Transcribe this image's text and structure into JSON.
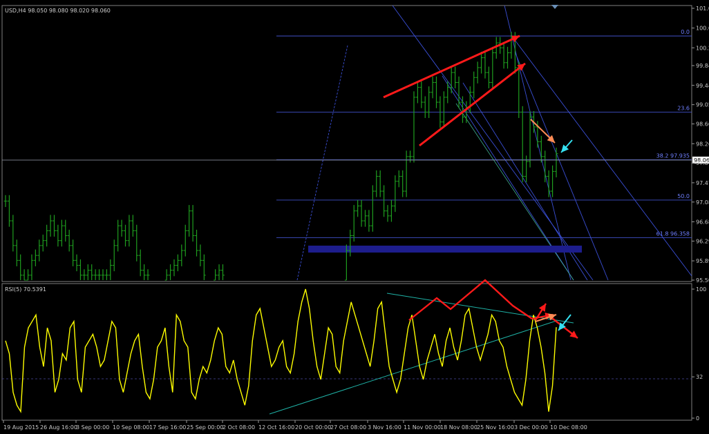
{
  "header": {
    "price_title": "USD,H4  98.050 98.080 98.020 98.060",
    "rsi_title": "RSI(5) 70.5391"
  },
  "current_price": "98.06",
  "colors": {
    "background": "#000000",
    "grid_frame": "#7f7f7f",
    "price": "#1f9f1f",
    "rsi": "#ffff00",
    "fib": "#4050c8",
    "trend": "#3a4fd6",
    "arrow_red": "#ff1a1a",
    "arrow_orange": "#ff8c55",
    "arrow_cyan": "#35e0f0",
    "rsi_trend": "#1fb3a7",
    "zone": "#1d1d8c"
  },
  "chart_data": [
    {
      "type": "line",
      "title": "USD,H4",
      "ylim": [
        95.5,
        101.0
      ],
      "y_ticks": [
        "101.0",
        "100.6",
        "100.2",
        "99.84",
        "99.44",
        "99.05",
        "98.66",
        "98.26",
        "97.87",
        "97.47",
        "97.08",
        "96.68",
        "96.29",
        "95.89",
        "95.50"
      ],
      "x_ticks": [
        "19 Aug 2015",
        "26 Aug 16:00",
        "3 Sep 00:00",
        "10 Sep 08:00",
        "17 Sep 16:00",
        "25 Sep 00:00",
        "2 Oct 08:00",
        "12 Oct 16:00",
        "20 Oct 00:00",
        "27 Oct 08:00",
        "3 Nov 16:00",
        "11 Nov 00:00",
        "18 Nov 08:00",
        "25 Nov 16:00",
        "3 Dec 00:00",
        "10 Dec 08:00"
      ],
      "fib_levels": [
        {
          "label": "0.0",
          "value": 100.44
        },
        {
          "label": "23.6",
          "value": 98.9
        },
        {
          "label": "38.2  97.935",
          "value": 97.935
        },
        {
          "label": "50.0",
          "value": 97.12
        },
        {
          "label": "61.8  96.358",
          "value": 96.358
        }
      ],
      "series": [
        {
          "values": [
            97.1,
            96.7,
            96.2,
            95.9,
            95.6,
            95.5,
            95.6,
            95.9,
            96.0,
            96.2,
            96.3,
            96.5,
            96.7,
            96.5,
            96.3,
            96.6,
            96.4,
            96.2,
            95.9,
            95.8,
            95.6,
            95.6,
            95.7,
            95.6,
            95.6,
            95.6,
            95.6,
            95.6,
            95.8,
            96.2,
            96.6,
            96.5,
            96.3,
            96.7,
            96.5,
            96.0,
            95.7,
            95.6,
            95.6,
            95.5,
            95.5,
            95.5,
            95.5,
            95.6,
            95.7,
            95.8,
            95.9,
            96.1,
            96.5,
            96.9,
            96.4,
            96.1,
            95.9,
            95.6,
            95.5,
            95.5,
            95.6,
            95.7,
            95.6,
            95.5,
            95.5,
            95.5,
            95.5,
            95.5,
            95.5,
            95.5,
            95.5,
            95.5,
            95.5,
            95.5,
            95.5,
            95.5,
            95.5,
            95.5,
            95.5,
            95.5,
            95.5,
            95.5,
            95.5,
            95.5,
            95.5,
            95.5,
            95.5,
            95.5,
            95.5,
            95.5,
            95.5,
            95.5,
            95.5,
            95.5,
            95.5,
            96.1,
            96.4,
            96.9,
            97.0,
            96.7,
            96.8,
            96.6,
            97.3,
            97.6,
            97.3,
            96.9,
            96.8,
            97.0,
            97.5,
            97.6,
            97.3,
            98.0,
            98.0,
            99.2,
            99.4,
            99.1,
            98.9,
            99.3,
            99.5,
            99.1,
            98.7,
            99.2,
            99.4,
            99.7,
            99.5,
            99.1,
            98.8,
            99.0,
            99.3,
            99.6,
            99.8,
            100.0,
            99.7,
            99.5,
            100.1,
            100.3,
            100.2,
            99.9,
            100.1,
            100.4,
            99.8,
            98.9,
            97.6,
            97.9,
            98.8,
            98.6,
            98.3,
            98.0,
            97.6,
            97.3,
            97.7,
            98.06
          ]
        }
      ]
    },
    {
      "type": "line",
      "title": "RSI(5) 70.5391",
      "ylim": [
        0,
        100
      ],
      "y_ticks": [
        "100",
        "32",
        "0"
      ],
      "series": [
        {
          "name": "RSI(5)",
          "values": [
            60,
            50,
            20,
            10,
            5,
            55,
            70,
            75,
            80,
            55,
            40,
            70,
            60,
            20,
            30,
            50,
            45,
            70,
            75,
            30,
            20,
            55,
            60,
            65,
            55,
            40,
            45,
            60,
            75,
            70,
            30,
            20,
            35,
            50,
            60,
            65,
            40,
            20,
            15,
            30,
            55,
            60,
            70,
            40,
            20,
            80,
            75,
            60,
            55,
            20,
            15,
            30,
            40,
            35,
            45,
            60,
            70,
            65,
            40,
            35,
            45,
            30,
            20,
            10,
            25,
            60,
            80,
            85,
            70,
            55,
            40,
            45,
            55,
            60,
            40,
            35,
            50,
            75,
            90,
            100,
            85,
            60,
            40,
            30,
            50,
            70,
            65,
            40,
            35,
            60,
            75,
            90,
            80,
            70,
            60,
            50,
            40,
            60,
            85,
            90,
            65,
            40,
            30,
            20,
            30,
            50,
            70,
            80,
            60,
            40,
            30,
            45,
            55,
            65,
            50,
            40,
            60,
            70,
            55,
            45,
            60,
            80,
            85,
            70,
            55,
            45,
            55,
            65,
            80,
            75,
            60,
            55,
            40,
            30,
            20,
            15,
            10,
            30,
            60,
            80,
            70,
            55,
            35,
            5,
            25,
            70.5
          ]
        }
      ]
    }
  ]
}
